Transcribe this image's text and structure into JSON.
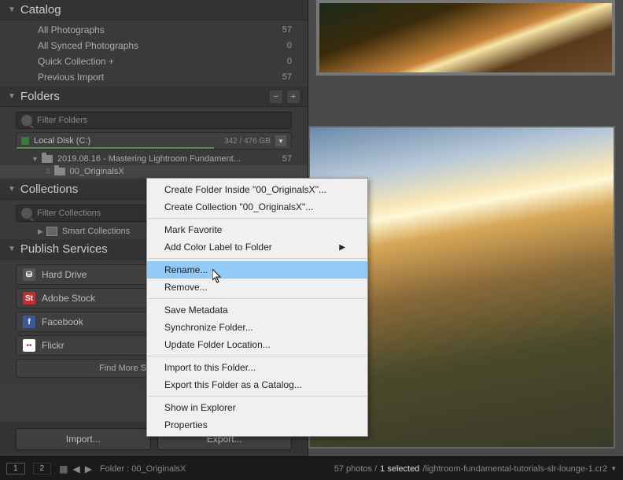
{
  "catalog": {
    "title": "Catalog",
    "items": [
      {
        "label": "All Photographs",
        "count": "57"
      },
      {
        "label": "All Synced Photographs",
        "count": "0"
      },
      {
        "label": "Quick Collection  +",
        "count": "0"
      },
      {
        "label": "Previous Import",
        "count": "57"
      }
    ]
  },
  "folders": {
    "title": "Folders",
    "filter_placeholder": "Filter Folders",
    "disk": {
      "name": "Local Disk (C:)",
      "usage": "342 / 476 GB"
    },
    "tree": [
      {
        "label": "2019.08.16 - Mastering Lightroom Fundament...",
        "count": "57"
      },
      {
        "label": "00_OriginalsX",
        "count": ""
      }
    ]
  },
  "collections": {
    "title": "Collections",
    "filter_placeholder": "Filter Collections",
    "items": [
      {
        "label": "Smart Collections"
      }
    ]
  },
  "publish": {
    "title": "Publish Services",
    "items": [
      {
        "label": "Hard Drive",
        "icon_bg": "#555",
        "icon_text": "⛁"
      },
      {
        "label": "Adobe Stock",
        "icon_bg": "#c03030",
        "icon_text": "St"
      },
      {
        "label": "Facebook",
        "icon_bg": "#3b5998",
        "icon_text": "f"
      },
      {
        "label": "Flickr",
        "icon_bg": "#fff",
        "icon_text": "••"
      }
    ],
    "find_more": "Find More Services Online..."
  },
  "buttons": {
    "import": "Import...",
    "export": "Export..."
  },
  "context_menu": {
    "items": [
      {
        "label": "Create Folder Inside \"00_OriginalsX\"..."
      },
      {
        "label": "Create Collection \"00_OriginalsX\"..."
      },
      {
        "sep": true
      },
      {
        "label": "Mark Favorite"
      },
      {
        "label": "Add Color Label to Folder",
        "submenu": true
      },
      {
        "sep": true
      },
      {
        "label": "Rename...",
        "hover": true
      },
      {
        "label": "Remove..."
      },
      {
        "sep": true
      },
      {
        "label": "Save Metadata"
      },
      {
        "label": "Synchronize Folder..."
      },
      {
        "label": "Update Folder Location..."
      },
      {
        "sep": true
      },
      {
        "label": "Import to this Folder..."
      },
      {
        "label": "Export this Folder as a Catalog..."
      },
      {
        "sep": true
      },
      {
        "label": "Show in Explorer"
      },
      {
        "label": "Properties"
      }
    ]
  },
  "status": {
    "view1": "1",
    "view2": "2",
    "folder_label": "Folder : 00_OriginalsX",
    "count": "57 photos /",
    "selected": "1 selected",
    "filepath": "/lightroom-fundamental-tutorials-slr-lounge-1.cr2"
  }
}
